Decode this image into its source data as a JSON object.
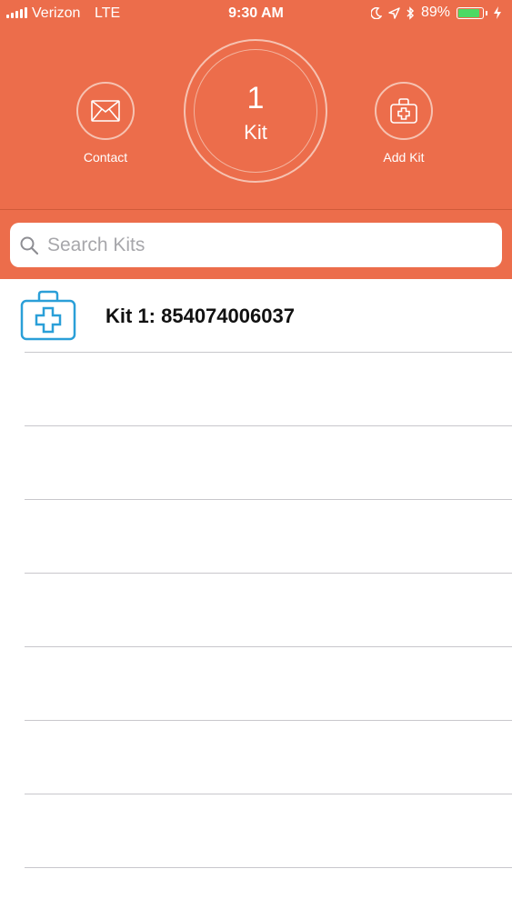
{
  "status_bar": {
    "carrier": "Verizon",
    "network": "LTE",
    "time": "9:30 AM",
    "battery_percent": "89%",
    "battery_level": 0.89,
    "icons": [
      "moon-icon",
      "location-arrow-icon",
      "bluetooth-icon",
      "charging-bolt-icon"
    ]
  },
  "header": {
    "contact_label": "Contact",
    "kit_count": "1",
    "kit_word": "Kit",
    "add_kit_label": "Add Kit",
    "accent_color": "#ec6d4b"
  },
  "search": {
    "placeholder": "Search Kits",
    "value": ""
  },
  "kits": [
    {
      "label": "Kit 1: 854074006037",
      "icon": "first-aid-kit-icon",
      "icon_color": "#2a9fd8"
    }
  ],
  "empty_rows": 7
}
